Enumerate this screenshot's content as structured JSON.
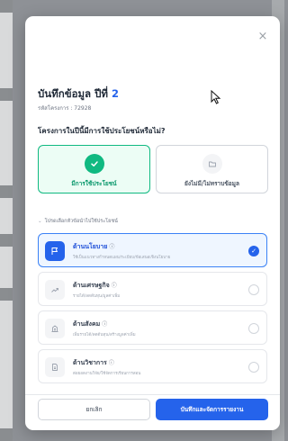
{
  "modal": {
    "close_glyph": "×",
    "title_prefix": "บันทึกข้อมูล ปีที่",
    "year_number": "2",
    "subtitle": "รหัสโครงการ : 72928",
    "question": "โครงการในปีนี้มีการใช้ประโยชน์หรือไม่?"
  },
  "choices": {
    "yes": {
      "label": "มีการใช้ประโยชน์",
      "icon": "check-icon"
    },
    "no": {
      "label": "ยังไม่มี/ไม่ทราบข้อมูล",
      "icon": "folder-icon"
    }
  },
  "section_label": "โปรดเลือกหัวข้อนำไปใช้ประโยชน์",
  "categories": [
    {
      "title": "ด้านนโยบาย",
      "desc": "ใช้เป็นแนวทางกำหนดแผน/ระเบียบ/ข้อเสนอเชิงนโยบาย",
      "selected": true,
      "icon": "flag-icon"
    },
    {
      "title": "ด้านเศรษฐกิจ",
      "desc": "รายได้/ลดต้นทุน/มูลค่าเพิ่ม",
      "selected": false,
      "icon": "trend-up-icon"
    },
    {
      "title": "ด้านสังคม",
      "desc": "เพิ่มรายได้/ลดต้นทุน/สร้างมูลค่าเพิ่ม",
      "selected": false,
      "icon": "building-icon"
    },
    {
      "title": "ด้านวิชาการ",
      "desc": "ต่อยอดงานวิจัย/ใช้จัดการเรียนการสอน",
      "selected": false,
      "icon": "document-icon"
    }
  ],
  "buttons": {
    "cancel": "ยกเลิก",
    "save": "บันทึกและจัดการรายงาน"
  },
  "colors": {
    "accent": "#2563eb",
    "success": "#10b981"
  }
}
